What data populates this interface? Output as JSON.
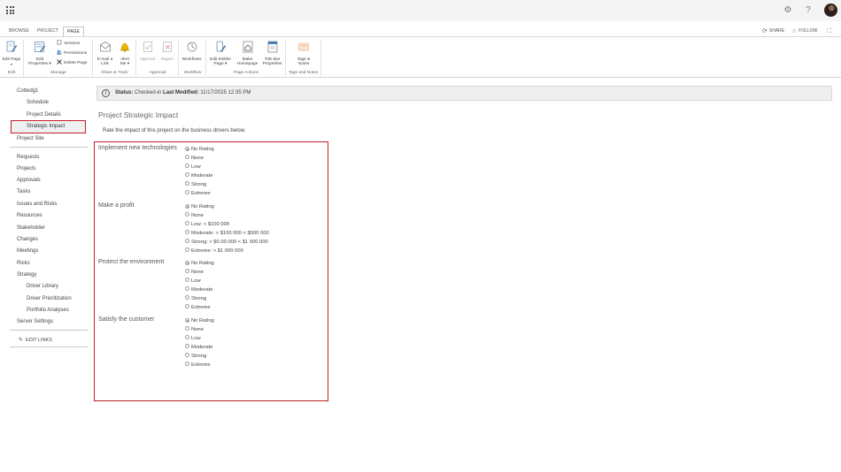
{
  "suitebar": {
    "gear_glyph": "⚙",
    "help_glyph": "?"
  },
  "ribbon_tabs": {
    "browse": "BROWSE",
    "project": "PROJECT",
    "page": "PAGE"
  },
  "top_right": {
    "share": "SHARE",
    "follow": "FOLLOW"
  },
  "ribbon": {
    "edit_page": "Edit Page",
    "edit_properties_1": "Edit",
    "edit_properties_2": "Properties ▾",
    "versions": "Versions",
    "permissions": "Permissions",
    "delete_page": "Delete Page",
    "email_link_1": "E-mail a",
    "email_link_2": "Link",
    "alert_me_1": "Alert",
    "alert_me_2": "Me ▾",
    "approve": "Approve",
    "reject": "Reject",
    "workflows": "Workflows",
    "edit_mobile_1": "Edit Mobile",
    "edit_mobile_2": "Page ▾",
    "make_homepage_1": "Make",
    "make_homepage_2": "Homepage",
    "title_bar_1": "Title Bar",
    "title_bar_2": "Properties",
    "tags_notes_1": "Tags &",
    "tags_notes_2": "Notes",
    "groups": {
      "edit": "Edit",
      "manage": "Manage",
      "share_track": "Share & Track",
      "approval": "Approval",
      "workflow": "Workflow",
      "page_actions": "Page Actions",
      "tags_notes": "Tags and Notes"
    }
  },
  "nav": {
    "project_name": "Cottedg1",
    "schedule": "Schedule",
    "project_details": "Project Details",
    "strategic_impact": "Strategic Impact",
    "project_site": "Project Site",
    "requests": "Requests",
    "projects": "Projects",
    "approvals": "Approvals",
    "tasks": "Tasks",
    "issues_risks": "Issues and Risks",
    "resources": "Resources",
    "stakeholder": "Stakeholder",
    "changes": "Changes",
    "meetings": "Meetings",
    "risks": "Risks",
    "strategy": "Strategy",
    "driver_library": "Driver Library",
    "driver_prioritization": "Driver Prioritization",
    "portfolio_analyses": "Portfolio Analyses",
    "server_settings": "Server Settings",
    "edit_links": "EDIT LINKS"
  },
  "status": {
    "status_label": "Status:",
    "status_value": "Checked-in",
    "modified_label": "Last Modified:",
    "modified_value": "11/17/2025 12:35 PM"
  },
  "main": {
    "title": "Project Strategic Impact",
    "intro": "Rate the impact of this project on the business drivers below."
  },
  "drivers": [
    {
      "name": "Implement new technologies",
      "options": [
        "No Rating",
        "None",
        "Low",
        "Moderate",
        "Strong",
        "Extreme"
      ],
      "selected": 0
    },
    {
      "name": "Make a profit",
      "options": [
        "No Rating",
        "None",
        "Low: < $100 000",
        "Moderate: > $100 000 < $500 000",
        "Strong: > $5.00 000 < $1 000 000",
        "Extreme: > $1 000 000"
      ],
      "selected": 0
    },
    {
      "name": "Protect the environment",
      "options": [
        "No Rating",
        "None",
        "Low",
        "Moderate",
        "Strong",
        "Extreme"
      ],
      "selected": 0
    },
    {
      "name": "Satisfy the customer",
      "options": [
        "No Rating",
        "None",
        "Low",
        "Moderate",
        "Strong",
        "Extreme"
      ],
      "selected": 0
    }
  ]
}
